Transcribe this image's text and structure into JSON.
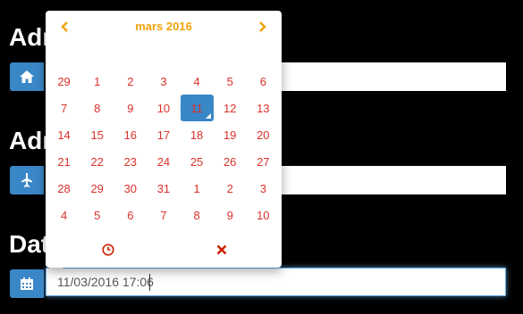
{
  "form": {
    "field1_label": "Adresse de départ",
    "field2_label": "Adresse d'arrivée",
    "field3_label": "Date",
    "date_value": "11/03/2016 17:06"
  },
  "icons": {
    "field1": "home-icon",
    "field2": "airplane-icon",
    "field3": "calendar-icon",
    "prev": "chevron-left-icon",
    "next": "chevron-right-icon",
    "time": "clock-icon",
    "clear": "close-icon"
  },
  "colors": {
    "accent": "#3a87c8",
    "month_title": "#f0a30a",
    "day_text": "#d9312b",
    "clear_icon": "#cc2200"
  },
  "calendar": {
    "month_label": "mars 2016",
    "weeks": [
      [
        "29",
        "1",
        "2",
        "3",
        "4",
        "5",
        "6"
      ],
      [
        "7",
        "8",
        "9",
        "10",
        "11",
        "12",
        "13"
      ],
      [
        "14",
        "15",
        "16",
        "17",
        "18",
        "19",
        "20"
      ],
      [
        "21",
        "22",
        "23",
        "24",
        "25",
        "26",
        "27"
      ],
      [
        "28",
        "29",
        "30",
        "31",
        "1",
        "2",
        "3"
      ],
      [
        "4",
        "5",
        "6",
        "7",
        "8",
        "9",
        "10"
      ]
    ],
    "selected": "11"
  }
}
